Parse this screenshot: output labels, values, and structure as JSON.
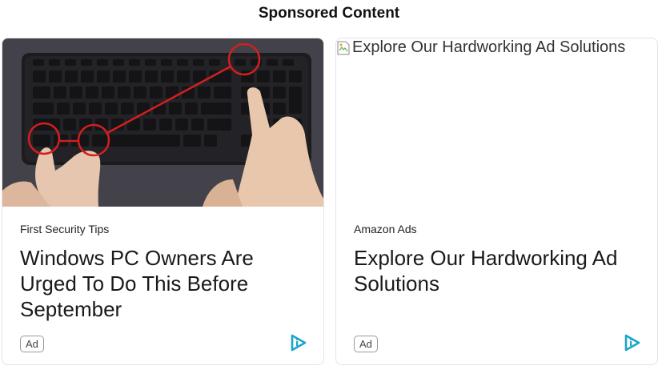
{
  "section": {
    "heading": "Sponsored Content"
  },
  "cards": [
    {
      "image_alt": "",
      "source": "First Security Tips",
      "title": "Windows PC Owners Are Urged To Do This Before September",
      "badge": "Ad",
      "adchoice_icon": "adchoices-icon"
    },
    {
      "image_alt": "Explore Our Hardworking Ad Solutions",
      "source": "Amazon Ads",
      "title": "Explore Our Hardworking Ad Solutions",
      "badge": "Ad",
      "adchoice_icon": "adchoices-icon"
    }
  ],
  "colors": {
    "adchoice": "#1aa6c8",
    "card_border": "#e4e4e4"
  }
}
